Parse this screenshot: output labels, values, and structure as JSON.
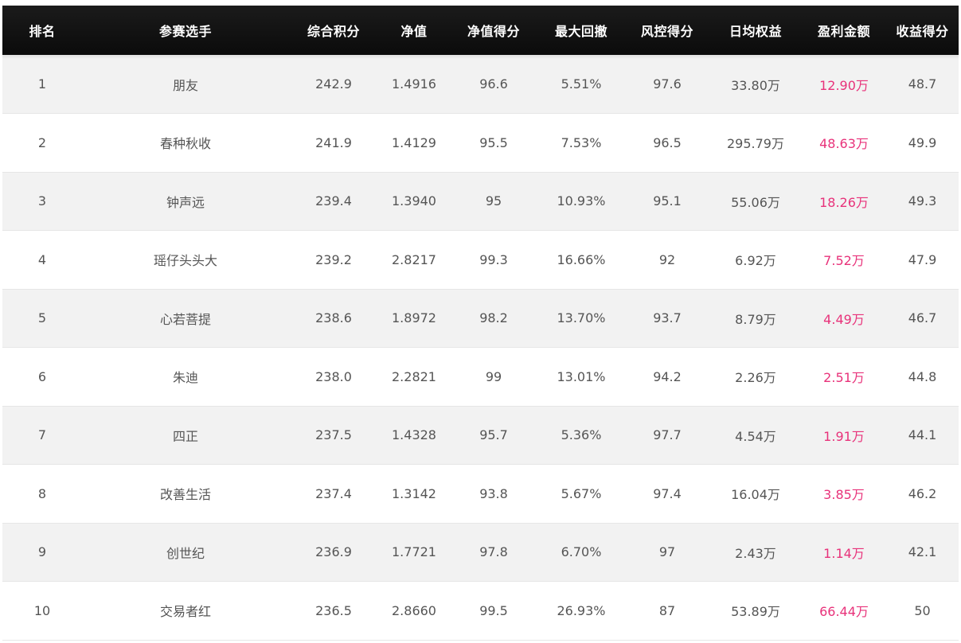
{
  "table": {
    "headers": [
      "排名",
      "参赛选手",
      "综合积分",
      "净值",
      "净值得分",
      "最大回撤",
      "风控得分",
      "日均权益",
      "盈利金额",
      "收益得分"
    ],
    "rows": [
      [
        "1",
        "朋友",
        "242.9",
        "1.4916",
        "96.6",
        "5.51%",
        "97.6",
        "33.80万",
        "12.90万",
        "48.7"
      ],
      [
        "2",
        "春种秋收",
        "241.9",
        "1.4129",
        "95.5",
        "7.53%",
        "96.5",
        "295.79万",
        "48.63万",
        "49.9"
      ],
      [
        "3",
        "钟声远",
        "239.4",
        "1.3940",
        "95",
        "10.93%",
        "95.1",
        "55.06万",
        "18.26万",
        "49.3"
      ],
      [
        "4",
        "瑶仔头头大",
        "239.2",
        "2.8217",
        "99.3",
        "16.66%",
        "92",
        "6.92万",
        "7.52万",
        "47.9"
      ],
      [
        "5",
        "心若菩提",
        "238.6",
        "1.8972",
        "98.2",
        "13.70%",
        "93.7",
        "8.79万",
        "4.49万",
        "46.7"
      ],
      [
        "6",
        "朱迪",
        "238.0",
        "2.2821",
        "99",
        "13.01%",
        "94.2",
        "2.26万",
        "2.51万",
        "44.8"
      ],
      [
        "7",
        "四正",
        "237.5",
        "1.4328",
        "95.7",
        "5.36%",
        "97.7",
        "4.54万",
        "1.91万",
        "44.1"
      ],
      [
        "8",
        "改善生活",
        "237.4",
        "1.3142",
        "93.8",
        "5.67%",
        "97.4",
        "16.04万",
        "3.85万",
        "46.2"
      ],
      [
        "9",
        "创世纪",
        "236.9",
        "1.7721",
        "97.8",
        "6.70%",
        "97",
        "2.43万",
        "1.14万",
        "42.1"
      ],
      [
        "10",
        "交易者红",
        "236.5",
        "2.8660",
        "99.5",
        "26.93%",
        "87",
        "53.89万",
        "66.44万",
        "50"
      ]
    ]
  },
  "colors": {
    "header_bg": "#111111",
    "header_text": "#ffffff",
    "row_alt_bg": "#f2f2f2",
    "text": "#555555",
    "profit_text": "#e8327a"
  }
}
